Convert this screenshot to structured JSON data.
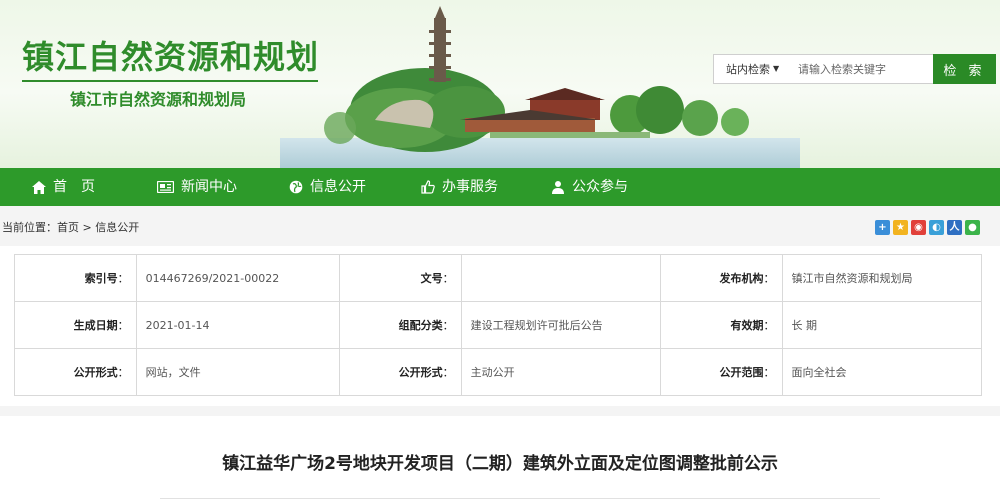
{
  "header": {
    "site_title": "镇江自然资源和规划",
    "site_subtitle": "镇江市自然资源和规划局"
  },
  "search": {
    "scope": "站内检索",
    "placeholder": "请输入检索关键字",
    "button": "检 索"
  },
  "nav": {
    "items": [
      {
        "label": "首　页",
        "icon": "home-icon"
      },
      {
        "label": "新闻中心",
        "icon": "newspaper-icon"
      },
      {
        "label": "信息公开",
        "icon": "globe-icon"
      },
      {
        "label": "办事服务",
        "icon": "thumbs-up-icon"
      },
      {
        "label": "公众参与",
        "icon": "people-icon"
      }
    ]
  },
  "breadcrumb": {
    "prefix": "当前位置：",
    "home": "首页",
    "separator": " > ",
    "current": "信息公开"
  },
  "share_icons": [
    "share-plus-icon",
    "qzone-icon",
    "weibo-icon",
    "tencent-weibo-icon",
    "renren-icon",
    "wechat-icon"
  ],
  "info": {
    "rows": [
      [
        {
          "label": "索引号",
          "value": "014467269/2021-00022"
        },
        {
          "label": "文号",
          "value": ""
        },
        {
          "label": "发布机构",
          "value": "镇江市自然资源和规划局"
        }
      ],
      [
        {
          "label": "生成日期",
          "value": "2021-01-14"
        },
        {
          "label": "组配分类",
          "value": "建设工程规划许可批后公告"
        },
        {
          "label": "有效期",
          "value": "长 期"
        }
      ],
      [
        {
          "label": "公开形式",
          "value": "网站，文件"
        },
        {
          "label": "公开形式",
          "value": "主动公开"
        },
        {
          "label": "公开范围",
          "value": "面向全社会"
        }
      ]
    ],
    "colon": "："
  },
  "article": {
    "title": "镇江益华广场2号地块开发项目（二期）建筑外立面及定位图调整批前公示"
  },
  "colors": {
    "brand_green": "#2f8c2b",
    "nav_green": "#2d9a2a",
    "button_green": "#2a8a26"
  }
}
